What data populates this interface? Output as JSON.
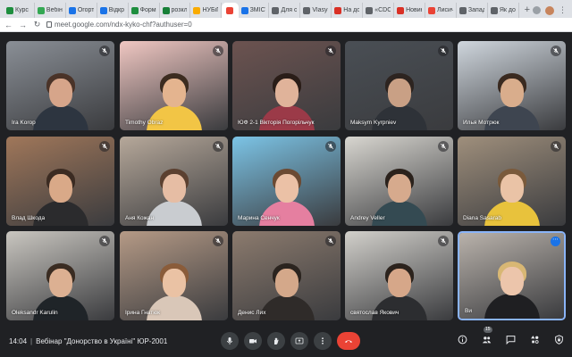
{
  "browser": {
    "tabs": [
      {
        "label": "Курс",
        "color": "#1e8e3e"
      },
      {
        "label": "Вебін",
        "color": "#34a853"
      },
      {
        "label": "Огорт",
        "color": "#1a73e8"
      },
      {
        "label": "Відкр",
        "color": "#1a73e8"
      },
      {
        "label": "Форм",
        "color": "#1e8e3e"
      },
      {
        "label": "розкл",
        "color": "#188038"
      },
      {
        "label": "НУБіП",
        "color": "#f9ab00"
      },
      {
        "label": "",
        "color": "#ea4335",
        "active": true
      },
      {
        "label": "ЗМІСТ",
        "color": "#1a73e8"
      },
      {
        "label": "Для о",
        "color": "#5f6368"
      },
      {
        "label": "Vlasyu",
        "color": "#5f6368"
      },
      {
        "label": "На до",
        "color": "#d93025"
      },
      {
        "label": "«CDC",
        "color": "#5f6368"
      },
      {
        "label": "Новин",
        "color": "#d93025"
      },
      {
        "label": "Лисич",
        "color": "#ea4335"
      },
      {
        "label": "Запад",
        "color": "#5f6368"
      },
      {
        "label": "Як до",
        "color": "#5f6368"
      }
    ],
    "new_tab": "+",
    "url": "meet.google.com/ndx-kyko-chf?authuser=0"
  },
  "participants": [
    {
      "name": "Ira Korop",
      "bg": "#8a8f96",
      "skin": "#d6a58a",
      "hair": "#4a3328",
      "shirt": "#2d3540"
    },
    {
      "name": "Timothy Obraz",
      "bg": "#f0c7c2",
      "skin": "#e4b48f",
      "hair": "#3c2c20",
      "shirt": "#f2c545"
    },
    {
      "name": "ЮФ 2-1 Вікторія Погорільчук",
      "bg": "#6c5350",
      "skin": "#e0b39a",
      "hair": "#2a1d18",
      "shirt": "#9b3a48"
    },
    {
      "name": "Maksym Kyrpniev",
      "bg": "#4a4f55",
      "skin": "#c9a085",
      "hair": "#2d2420",
      "shirt": "#2e3238"
    },
    {
      "name": "Илья Мотрюк",
      "bg": "#cfd6dd",
      "skin": "#d9ad8c",
      "hair": "#3a2a20",
      "shirt": "#3e4550"
    },
    {
      "name": "Влад Шкода",
      "bg": "#a0775a",
      "skin": "#d9a988",
      "hair": "#3b2b22",
      "shirt": "#2b2b2d"
    },
    {
      "name": "Аня Кожан",
      "bg": "#b6a89a",
      "skin": "#e6bda4",
      "hair": "#5b4030",
      "shirt": "#c9ccd0"
    },
    {
      "name": "Марина Сенчук",
      "bg": "#7cc4e6",
      "skin": "#ebc1a6",
      "hair": "#6b4a33",
      "shirt": "#e57fa0"
    },
    {
      "name": "Andrey Veller",
      "bg": "#d8d6d0",
      "skin": "#d6aa8d",
      "hair": "#2b221c",
      "shirt": "#344a52"
    },
    {
      "name": "Diana Sasarab",
      "bg": "#9f8f7c",
      "skin": "#eac3a6",
      "hair": "#7a5a3b",
      "shirt": "#e8c23c"
    },
    {
      "name": "Oleksandr Karulin",
      "bg": "#c9c6c0",
      "skin": "#dcb092",
      "hair": "#3a2c22",
      "shirt": "#1f2428"
    },
    {
      "name": "Ірина Гнатюк",
      "bg": "#b59a86",
      "skin": "#eac2a4",
      "hair": "#8a5c3a",
      "shirt": "#d9c7b8"
    },
    {
      "name": "Денис Лих",
      "bg": "#8c7b6e",
      "skin": "#d4a88a",
      "hair": "#2b241f",
      "shirt": "#2f2b29"
    },
    {
      "name": "святослав Якович",
      "bg": "#d2d0cb",
      "skin": "#d6a789",
      "hair": "#2c231d",
      "shirt": "#2c2d30"
    },
    {
      "name": "Ви",
      "bg": "#b9b2ab",
      "skin": "#ecc5ab",
      "hair": "#d8b774",
      "shirt": "#1f1f22",
      "self": true
    }
  ],
  "bottombar": {
    "time": "14:04",
    "separator": "|",
    "meeting_title": "Вебінар \"Донорство в Україні\" ЮР-2001",
    "participants_count": "15"
  },
  "colors": {
    "end_call": "#ea4335",
    "self_border": "#8ab4f8",
    "accent": "#1a73e8"
  }
}
